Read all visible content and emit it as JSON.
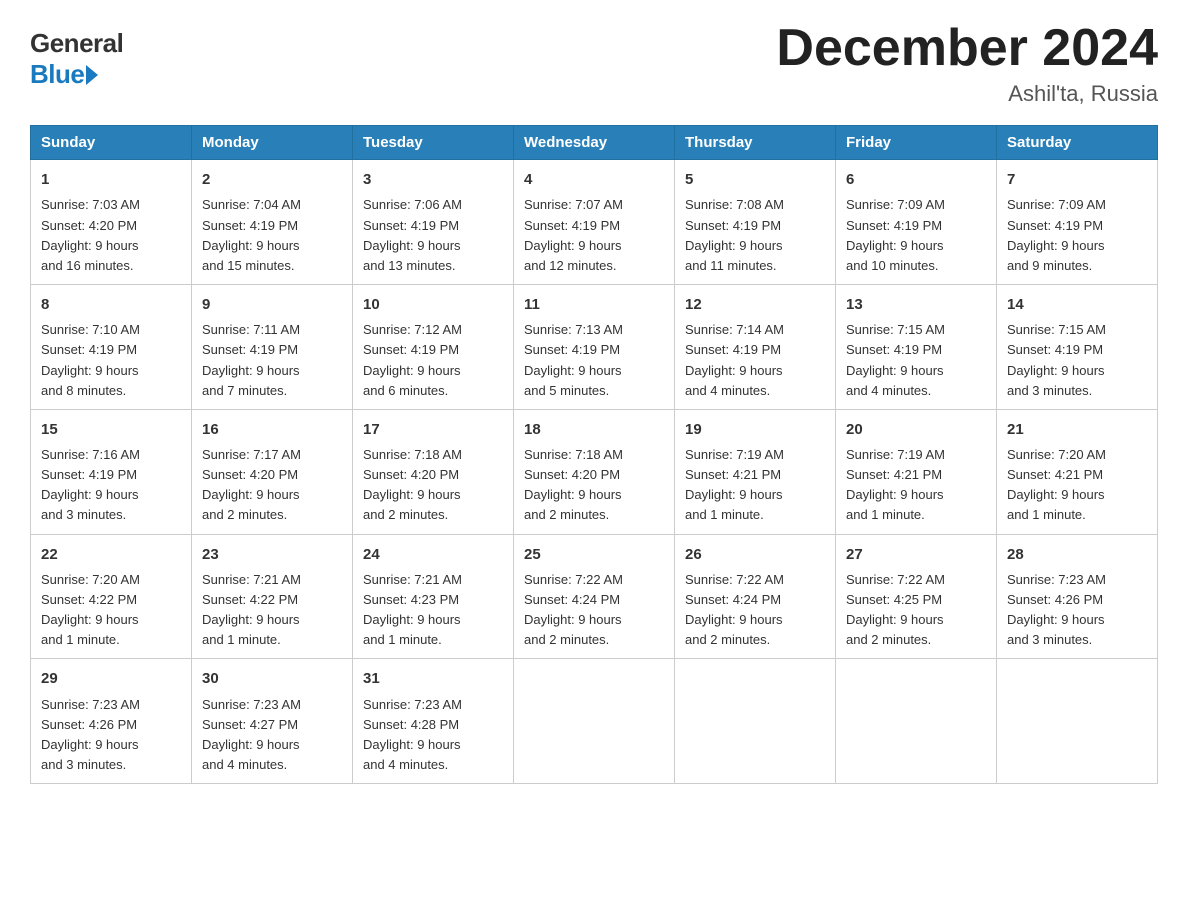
{
  "logo": {
    "general": "General",
    "blue": "Blue"
  },
  "header": {
    "month_year": "December 2024",
    "location": "Ashil'ta, Russia"
  },
  "days_of_week": [
    "Sunday",
    "Monday",
    "Tuesday",
    "Wednesday",
    "Thursday",
    "Friday",
    "Saturday"
  ],
  "weeks": [
    [
      {
        "day": "1",
        "sunrise": "7:03 AM",
        "sunset": "4:20 PM",
        "daylight": "9 hours and 16 minutes."
      },
      {
        "day": "2",
        "sunrise": "7:04 AM",
        "sunset": "4:19 PM",
        "daylight": "9 hours and 15 minutes."
      },
      {
        "day": "3",
        "sunrise": "7:06 AM",
        "sunset": "4:19 PM",
        "daylight": "9 hours and 13 minutes."
      },
      {
        "day": "4",
        "sunrise": "7:07 AM",
        "sunset": "4:19 PM",
        "daylight": "9 hours and 12 minutes."
      },
      {
        "day": "5",
        "sunrise": "7:08 AM",
        "sunset": "4:19 PM",
        "daylight": "9 hours and 11 minutes."
      },
      {
        "day": "6",
        "sunrise": "7:09 AM",
        "sunset": "4:19 PM",
        "daylight": "9 hours and 10 minutes."
      },
      {
        "day": "7",
        "sunrise": "7:09 AM",
        "sunset": "4:19 PM",
        "daylight": "9 hours and 9 minutes."
      }
    ],
    [
      {
        "day": "8",
        "sunrise": "7:10 AM",
        "sunset": "4:19 PM",
        "daylight": "9 hours and 8 minutes."
      },
      {
        "day": "9",
        "sunrise": "7:11 AM",
        "sunset": "4:19 PM",
        "daylight": "9 hours and 7 minutes."
      },
      {
        "day": "10",
        "sunrise": "7:12 AM",
        "sunset": "4:19 PM",
        "daylight": "9 hours and 6 minutes."
      },
      {
        "day": "11",
        "sunrise": "7:13 AM",
        "sunset": "4:19 PM",
        "daylight": "9 hours and 5 minutes."
      },
      {
        "day": "12",
        "sunrise": "7:14 AM",
        "sunset": "4:19 PM",
        "daylight": "9 hours and 4 minutes."
      },
      {
        "day": "13",
        "sunrise": "7:15 AM",
        "sunset": "4:19 PM",
        "daylight": "9 hours and 4 minutes."
      },
      {
        "day": "14",
        "sunrise": "7:15 AM",
        "sunset": "4:19 PM",
        "daylight": "9 hours and 3 minutes."
      }
    ],
    [
      {
        "day": "15",
        "sunrise": "7:16 AM",
        "sunset": "4:19 PM",
        "daylight": "9 hours and 3 minutes."
      },
      {
        "day": "16",
        "sunrise": "7:17 AM",
        "sunset": "4:20 PM",
        "daylight": "9 hours and 2 minutes."
      },
      {
        "day": "17",
        "sunrise": "7:18 AM",
        "sunset": "4:20 PM",
        "daylight": "9 hours and 2 minutes."
      },
      {
        "day": "18",
        "sunrise": "7:18 AM",
        "sunset": "4:20 PM",
        "daylight": "9 hours and 2 minutes."
      },
      {
        "day": "19",
        "sunrise": "7:19 AM",
        "sunset": "4:21 PM",
        "daylight": "9 hours and 1 minute."
      },
      {
        "day": "20",
        "sunrise": "7:19 AM",
        "sunset": "4:21 PM",
        "daylight": "9 hours and 1 minute."
      },
      {
        "day": "21",
        "sunrise": "7:20 AM",
        "sunset": "4:21 PM",
        "daylight": "9 hours and 1 minute."
      }
    ],
    [
      {
        "day": "22",
        "sunrise": "7:20 AM",
        "sunset": "4:22 PM",
        "daylight": "9 hours and 1 minute."
      },
      {
        "day": "23",
        "sunrise": "7:21 AM",
        "sunset": "4:22 PM",
        "daylight": "9 hours and 1 minute."
      },
      {
        "day": "24",
        "sunrise": "7:21 AM",
        "sunset": "4:23 PM",
        "daylight": "9 hours and 1 minute."
      },
      {
        "day": "25",
        "sunrise": "7:22 AM",
        "sunset": "4:24 PM",
        "daylight": "9 hours and 2 minutes."
      },
      {
        "day": "26",
        "sunrise": "7:22 AM",
        "sunset": "4:24 PM",
        "daylight": "9 hours and 2 minutes."
      },
      {
        "day": "27",
        "sunrise": "7:22 AM",
        "sunset": "4:25 PM",
        "daylight": "9 hours and 2 minutes."
      },
      {
        "day": "28",
        "sunrise": "7:23 AM",
        "sunset": "4:26 PM",
        "daylight": "9 hours and 3 minutes."
      }
    ],
    [
      {
        "day": "29",
        "sunrise": "7:23 AM",
        "sunset": "4:26 PM",
        "daylight": "9 hours and 3 minutes."
      },
      {
        "day": "30",
        "sunrise": "7:23 AM",
        "sunset": "4:27 PM",
        "daylight": "9 hours and 4 minutes."
      },
      {
        "day": "31",
        "sunrise": "7:23 AM",
        "sunset": "4:28 PM",
        "daylight": "9 hours and 4 minutes."
      },
      null,
      null,
      null,
      null
    ]
  ],
  "labels": {
    "sunrise": "Sunrise:",
    "sunset": "Sunset:",
    "daylight": "Daylight:"
  }
}
